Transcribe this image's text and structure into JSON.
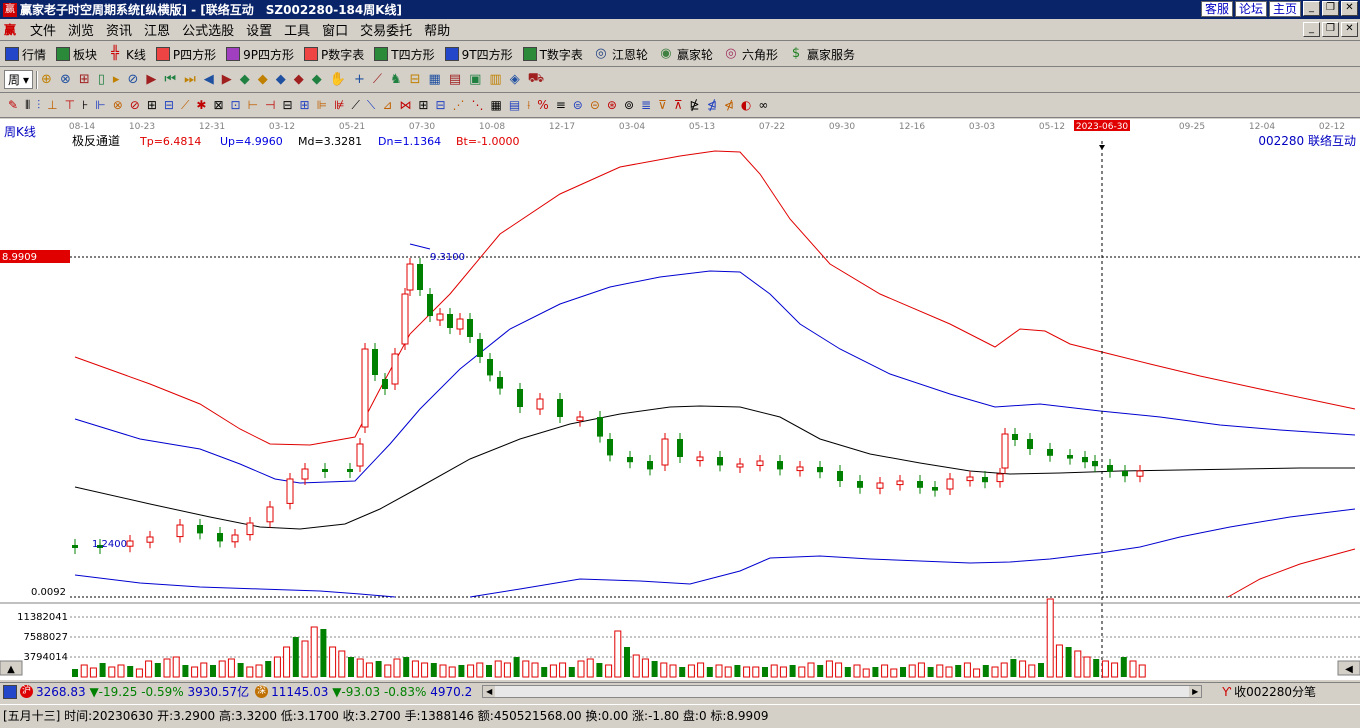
{
  "window": {
    "title": "赢家老子时空周期系统[纵横版] - [联络互动　SZ002280-184周K线]",
    "links": [
      "客服",
      "论坛",
      "主页"
    ]
  },
  "menu": [
    "文件",
    "浏览",
    "资讯",
    "江恩",
    "公式选股",
    "设置",
    "工具",
    "窗口",
    "交易委托",
    "帮助"
  ],
  "toolbar1": [
    "行情",
    "板块",
    "K线",
    "P四方形",
    "9P四方形",
    "P数字表",
    "T四方形",
    "9T四方形",
    "T数字表",
    "江恩轮",
    "赢家轮",
    "六角形",
    "赢家服务"
  ],
  "toolbar2": {
    "period_label": "周"
  },
  "chart": {
    "period_label": "周K线",
    "indicator": {
      "name": "极反通道",
      "params": [
        {
          "label": "Tp=6.4814",
          "color": "#e00000"
        },
        {
          "label": "Up=4.9960",
          "color": "#0000e0"
        },
        {
          "label": "Md=3.3281",
          "color": "#000000"
        },
        {
          "label": "Dn=1.1364",
          "color": "#0000e0"
        },
        {
          "label": "Bt=-1.0000",
          "color": "#e00000"
        }
      ]
    },
    "stock_label": "002280 联络互动",
    "date_ticks": [
      "08-14",
      "10-23",
      "12-31",
      "03-12",
      "05-21",
      "07-30",
      "10-08",
      "12-17",
      "03-04",
      "05-13",
      "07-22",
      "09-30",
      "12-16",
      "03-03",
      "05-12",
      "2023-06-30",
      "09-25",
      "12-04",
      "02-12"
    ],
    "highlight_date": "2023-06-30",
    "price_marker": "8.9909",
    "high_label": "9.3100",
    "low_label": "1.2400",
    "bottom_label": "0.0092",
    "volume_ticks": [
      "11382041",
      "7588027",
      "3794014"
    ]
  },
  "chart_data": {
    "type": "candlestick",
    "description_series": [
      "Tp",
      "Up",
      "Md",
      "Dn",
      "Bt"
    ],
    "price_ylim": [
      0.0092,
      11.5
    ],
    "high": 9.31,
    "low": 1.24
  },
  "status": {
    "sh_badge": "沪",
    "sh_index": "3268.83",
    "sh_change": "▼-19.25",
    "sh_pct": "-0.59%",
    "sh_amount": "3930.57亿",
    "sz_badge": "深",
    "sz_index": "11145.03",
    "sz_change": "▼-93.03",
    "sz_pct": "-0.83%",
    "sz_amount": "4970.2",
    "right_label": "收002280分笔"
  },
  "info": "[五月十三] 时间:20230630 开:3.2900 高:3.3200 低:3.1700 收:3.2700 手:1388146 额:450521568.00 换:0.00 涨:-1.80 盘:0 标:8.9909"
}
